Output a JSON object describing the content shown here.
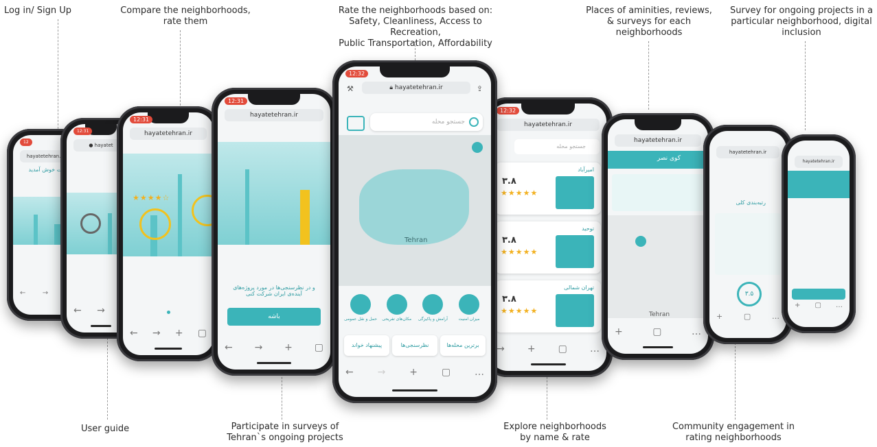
{
  "captions": {
    "login": "Log in/ Sign Up",
    "compare": "Compare the neighborhoods,\nrate them",
    "rate": "Rate the neighborhoods based on:\nSafety, Cleanliness, Access to Recreation,\nPublic Transportation, Affordability",
    "places": "Places of aminities, reviews,\n& surveys for each\nneighborhoods",
    "survey_projects": "Survey for ongoing projects in a\nparticular neighborhood, digital\ninclusion",
    "user_guide": "User guide",
    "participate": "Participate in surveys of\nTehran`s ongoing projects",
    "explore": "Explore neighborhoods\nby name & rate",
    "community": "Community engagement in\nrating neighborhoods"
  },
  "center_phone": {
    "time": "12:32",
    "url": "hayatetehran.ir",
    "search_placeholder": "جستجو محله",
    "map_label": "Tehran",
    "categories": [
      "حمل و نقل عمومی",
      "مکان‌های تفریحی",
      "آرامش و پاکیزگی",
      "میزان امنیت"
    ],
    "tabs": [
      "پیشنهاد خواند",
      "نظرسنجی‌ها",
      "برترین محله‌ها"
    ]
  },
  "phones": {
    "p1_url": "hayatetehran.ir",
    "p1_title": "به حیات خوش آمدید",
    "p3_url": "hayatetehran.ir",
    "p4_url": "hayatetehran.ir",
    "p4_text": "و در نظرسنجی‌ها در مورد پروژه‌های آینده‌ی ایران شرکت کنی",
    "p4_button": "باشه",
    "p6_url": "hayatetehran.ir",
    "p6_search": "جستجو محله",
    "p6_items": [
      {
        "name": "امیرآباد",
        "score": "۳.۸"
      },
      {
        "name": "توحید",
        "score": "۳.۸"
      },
      {
        "name": "تهران شمالی",
        "score": "۳.۸"
      }
    ],
    "p7_url": "hayatetehran.ir",
    "p7_title": "کوی نصر",
    "p7_map_label": "Tehran",
    "p8_url": "hayatetehran.ir",
    "p8_heading": "رتبه‌بندی کلی",
    "p8_score": "۳.۵",
    "p9_url": "hayatetehran.ir"
  },
  "colors": {
    "accent": "#3bb4b9",
    "time_badge": "#e24b3b"
  }
}
